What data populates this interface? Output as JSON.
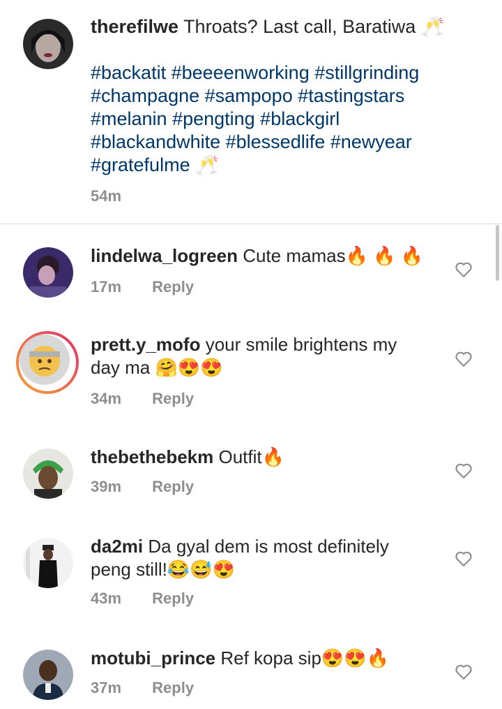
{
  "caption": {
    "username": "therefilwe",
    "text": "Throats? Last call, Baratiwa 🥂",
    "hashtags": "#backatit #beeeenworking #stillgrinding #champagne #sampopo #tastingstars #melanin #pengting #blackgirl #blackandwhite #blessedlife #newyear #gratefulme 🥂",
    "time": "54m"
  },
  "comments": [
    {
      "username": "lindelwa_logreen",
      "text": "Cute mamas🔥 🔥 🔥",
      "time": "17m",
      "reply": "Reply"
    },
    {
      "username": "prett.y_mofo",
      "text": "your smile brightens my day ma 🤗😍😍",
      "time": "34m",
      "reply": "Reply"
    },
    {
      "username": "thebethebekm",
      "text": "Outfit🔥",
      "time": "39m",
      "reply": "Reply"
    },
    {
      "username": "da2mi",
      "text": "Da gyal dem is most definitely peng still!😂😅😍",
      "time": "43m",
      "reply": "Reply"
    },
    {
      "username": "motubi_prince",
      "text": "Ref kopa sip😍😍🔥",
      "time": "37m",
      "reply": "Reply"
    }
  ],
  "colors": {
    "hashtag": "#00376b",
    "meta": "#8e8e8e",
    "text": "#262626"
  }
}
